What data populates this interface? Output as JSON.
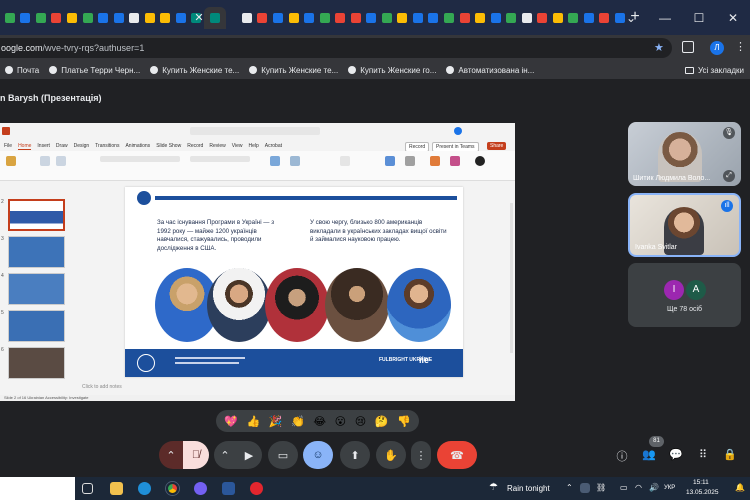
{
  "browser": {
    "url_prefix": "oogle.com",
    "url_rest": "/wve-tvry-rqs?authuser=1",
    "profile_initial": "Л"
  },
  "bookmarks": [
    {
      "label": "Почта"
    },
    {
      "label": "Платье Терри Черн..."
    },
    {
      "label": "Купить Женские те..."
    },
    {
      "label": "Купить Женские те..."
    },
    {
      "label": "Купить Женские го..."
    },
    {
      "label": "Автоматизована ін..."
    }
  ],
  "bookmarks_folder": "Усі закладки",
  "meet": {
    "title": "n Barysh (Презентація)"
  },
  "ppt": {
    "menu": [
      "File",
      "Home",
      "Insert",
      "Draw",
      "Design",
      "Transitions",
      "Animations",
      "Slide Show",
      "Record",
      "Review",
      "View",
      "Help",
      "Acrobat"
    ],
    "record": "Record",
    "present": "Present in Teams",
    "share": "Share",
    "add_notes": "Click to add notes",
    "status": "Slide 2 of 16    Ukrainian    Accessibility: Investigate",
    "thumb_numbers": [
      "2",
      "3",
      "4",
      "5",
      "6"
    ]
  },
  "slide": {
    "text_left": "За час існування Програми в Україні — з 1992 року — майже 1200 українців навчалися, стажувались, проводили дослідження в США.",
    "text_right": "У свою чергу, близько 800 американців викладали в українських закладах вищої освіти й займалися науковою працею.",
    "footer_fulbright": "FULBRIGHT UKRAINE",
    "footer_iie": "iie"
  },
  "participants": [
    {
      "name": "Шитик Людмила Воло..."
    },
    {
      "name": "Ivanka Svitlar"
    }
  ],
  "others": {
    "initials": [
      "І",
      "А"
    ],
    "label": "Ще 78 осіб"
  },
  "reactions": [
    "💖",
    "👍",
    "🎉",
    "👏",
    "😂",
    "😮",
    "😢",
    "🤔",
    "👎"
  ],
  "controls": {
    "participants_count": "81"
  },
  "taskbar": {
    "weather": "Rain tonight",
    "lang": "УКР",
    "time": "15:11",
    "date": "13.05.2025"
  },
  "colors": {
    "end_call": "#ea4335",
    "mic_off": "#f9dedc",
    "reaction_active": "#8ab4f8",
    "slide_blue": "#1c4f9c"
  }
}
